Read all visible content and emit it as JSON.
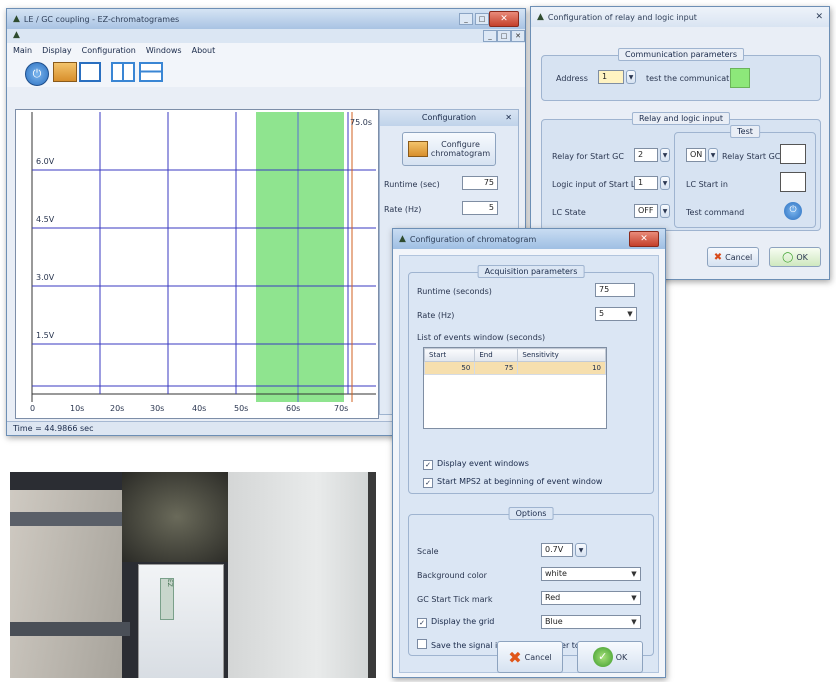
{
  "main_window": {
    "title": "LE / GC coupling - EZ-chromatogrames",
    "menu": [
      "Main",
      "Display",
      "Configuration",
      "Windows",
      "About"
    ],
    "y_tick_labels": [
      "6.0V",
      "4.5V",
      "3.0V",
      "1.5V"
    ],
    "x_tick_labels": [
      "0",
      "10s",
      "20s",
      "30s",
      "40s",
      "50s",
      "60s",
      "70s"
    ],
    "right_marker": "75.0s",
    "status": "Time = 44.9866 sec"
  },
  "config_panel": {
    "title": "Configuration",
    "button_label": "Configure chromatogram",
    "fields": [
      {
        "label": "Runtime (sec)",
        "value": "75"
      },
      {
        "label": "Rate (Hz)",
        "value": "5"
      }
    ]
  },
  "relay_dialog": {
    "title": "Configuration of relay and logic input",
    "comm_group": "Communication parameters",
    "address_label": "Address",
    "address_value": "1",
    "test_label": "test the communication",
    "relay_group": "Relay and logic input",
    "test_group": "Test",
    "relay_label": "Relay for Start GC",
    "relay_value": "2",
    "on_value": "ON",
    "relay_test_label": "Relay Start GC",
    "logic_label": "Logic input of Start LC",
    "logic_value": "1",
    "lc_start_test_label": "LC Start in",
    "lc_state_label": "LC State",
    "lc_state_value": "OFF",
    "test_cmd_label": "Test command",
    "cancel": "Cancel",
    "ok": "OK"
  },
  "chrom_dialog": {
    "title": "Configuration of chromatogram",
    "group1": "Acquisition parameters",
    "runtime_label": "Runtime (seconds)",
    "runtime_value": "75",
    "rate_label": "Rate (Hz)",
    "rate_value": "5",
    "list_label": "List of events window (seconds)",
    "columns": [
      "Start",
      "End",
      "Sensitivity"
    ],
    "rows": [
      [
        "50",
        "75",
        "10"
      ]
    ],
    "check1": "Display event windows",
    "check2": "Start MPS2 at beginning of event window",
    "group2": "Options",
    "scale_label": "Scale",
    "scale_value": "0.7V",
    "bg_label": "Background color",
    "bg_value": "white",
    "gc_label": "GC Start Tick mark",
    "gc_value": "Red",
    "grid_label": "Display the grid",
    "grid_value": "Blue",
    "save_label": "Save the signal in a file to transfer to Excel",
    "cancel": "Cancel",
    "ok": "OK"
  },
  "photo": {
    "label": "EZ"
  }
}
